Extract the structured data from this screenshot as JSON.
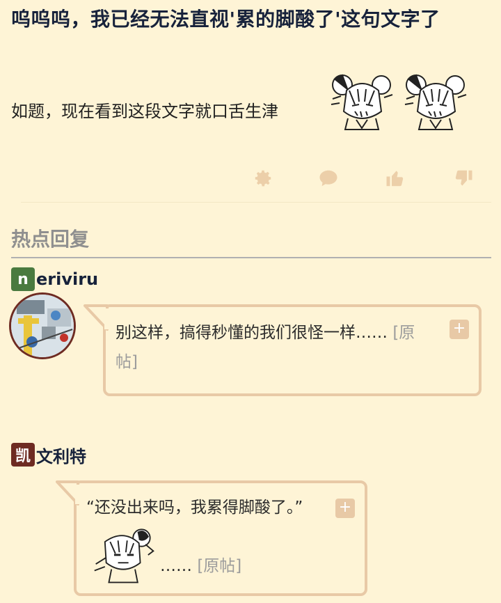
{
  "post": {
    "title": "呜呜呜，我已经无法直视'累的脚酸了'这句文字了",
    "body": "如题，现在看到这段文字就口舌生津"
  },
  "actions": [
    {
      "name": "settings",
      "icon": "gear-icon"
    },
    {
      "name": "comment",
      "icon": "comment-icon"
    },
    {
      "name": "like",
      "icon": "thumbs-up-icon"
    },
    {
      "name": "dislike",
      "icon": "thumbs-down-icon"
    }
  ],
  "hot_replies": {
    "heading": "热点回复",
    "items": [
      {
        "badge": "n",
        "badge_color": "#4a7a3f",
        "username": "eriviru",
        "text_prefix": "别这样，搞得秒懂的我们很怪一样……",
        "text_line2": "帖]",
        "link_label_a": "[原",
        "plus": "+"
      },
      {
        "badge": "凯",
        "badge_color": "#6e2b22",
        "username": "文利特",
        "quote": "“还没出来吗，我累得脚酸了。”",
        "ellipsis": "……",
        "link_label": "[原帖]",
        "plus": "+"
      }
    ]
  },
  "colors": {
    "background": "#fef4d6",
    "bubble_border": "#e8c9a6",
    "icon": "#eccfa9"
  }
}
